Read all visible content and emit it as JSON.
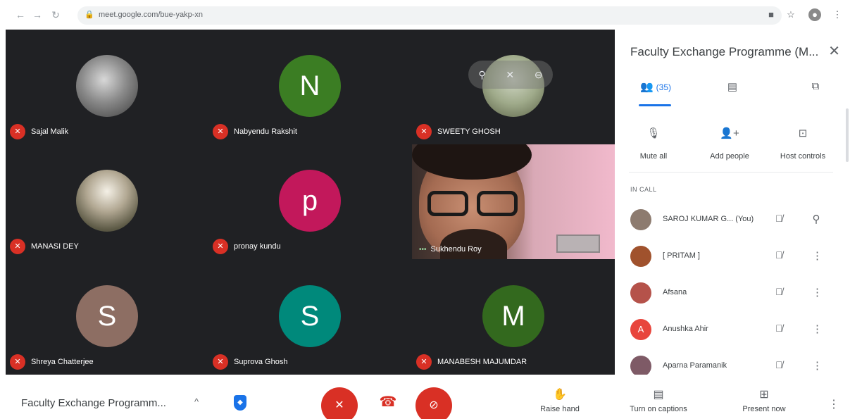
{
  "browser": {
    "url": "meet.google.com/bue-yakp-xn",
    "icons": [
      "back-icon",
      "forward-icon",
      "reload-icon",
      "lock-icon",
      "camera-icon",
      "star-icon",
      "profile-icon",
      "menu-icon"
    ]
  },
  "tiles": [
    {
      "name": "Sajal Malik",
      "avatar": "",
      "avatar_color": "#555555",
      "type": "photo"
    },
    {
      "name": "Nabyendu Rakshit",
      "avatar": "N",
      "avatar_color": "#3b7d23",
      "type": "letter"
    },
    {
      "name": "SWEETY GHOSH",
      "avatar": "",
      "avatar_color": "#9faa8a",
      "type": "sweety"
    },
    {
      "name": "MANASI DEY",
      "avatar": "",
      "avatar_color": "#7a735c",
      "type": "lake"
    },
    {
      "name": "pronay kundu",
      "avatar": "p",
      "avatar_color": "#c2185b",
      "type": "letter"
    },
    {
      "name": "Shreya Chatterjee",
      "avatar": "S",
      "avatar_color": "#8d6e63",
      "type": "letter"
    },
    {
      "name": "Suprova Ghosh",
      "avatar": "S",
      "avatar_color": "#00897b",
      "type": "letter"
    },
    {
      "name": "MANABESH MAJUMDAR",
      "avatar": "M",
      "avatar_color": "#33691e",
      "type": "letter"
    }
  ],
  "active_speaker": {
    "name": "Sukhendu Roy"
  },
  "panel": {
    "title": "Faculty Exchange Programme (M...",
    "people_count": "(35)",
    "actions": [
      {
        "label": "Mute all",
        "icon": "mic-off-icon"
      },
      {
        "label": "Add people",
        "icon": "add-person-icon"
      },
      {
        "label": "Host controls",
        "icon": "host-controls-icon"
      }
    ],
    "section_label": "IN CALL",
    "people": [
      {
        "name": "SAROJ KUMAR G...  (You)",
        "initial": "",
        "color": "#8d7b6f"
      },
      {
        "name": "[ PRITAM ]",
        "initial": "",
        "color": "#a0522d"
      },
      {
        "name": "Afsana",
        "initial": "",
        "color": "#b5524a"
      },
      {
        "name": "Anushka Ahir",
        "initial": "A",
        "color": "#e8453c"
      },
      {
        "name": "Aparna Paramanik",
        "initial": "",
        "color": "#7e5a66"
      }
    ]
  },
  "bottom": {
    "meeting_title": "Faculty Exchange Programm...",
    "raise_hand": "Raise hand",
    "captions": "Turn on captions",
    "present": "Present now"
  },
  "colors": {
    "red": "#d93025",
    "blue": "#1a73e8",
    "dark": "#202124"
  }
}
